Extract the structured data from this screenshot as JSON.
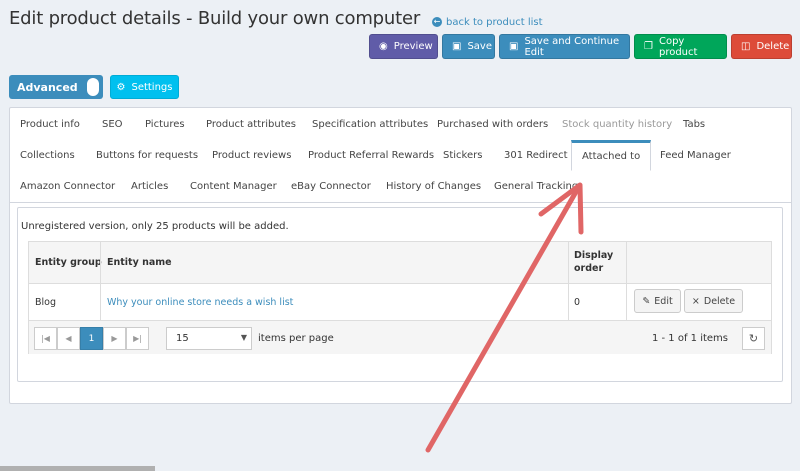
{
  "header": {
    "title": "Edit product details - Build your own computer",
    "back_link": "back to product list",
    "back_icon": "arrow-circle-left-icon"
  },
  "actions": {
    "preview": "Preview",
    "save": "Save",
    "save_continue": "Save and Continue Edit",
    "copy": "Copy product",
    "delete": "Delete"
  },
  "mode_toggle": {
    "label": "Advanced"
  },
  "settings_button": {
    "label": "Settings"
  },
  "tabs": {
    "row1": [
      "Product info",
      "SEO",
      "Pictures",
      "Product attributes",
      "Specification attributes",
      "Purchased with orders",
      "Stock quantity history",
      "Tabs"
    ],
    "row2": [
      "Collections",
      "Buttons for requests",
      "Product reviews",
      "Product Referral Rewards",
      "Stickers",
      "301 Redirect",
      "Attached to",
      "Feed Manager"
    ],
    "row3": [
      "Amazon Connector",
      "Articles",
      "Content Manager",
      "eBay Connector",
      "History of Changes",
      "General Tracking"
    ],
    "active": "Attached to"
  },
  "notice": "Unregistered version, only 25 products will be added.",
  "grid": {
    "columns": [
      "Entity group",
      "Entity name",
      "Display",
      "order"
    ],
    "rows": [
      {
        "group": "Blog",
        "name": "Why your online store needs a wish list",
        "order": "0",
        "edit": "Edit",
        "delete": "Delete"
      }
    ]
  },
  "pager": {
    "current_page": "1",
    "page_size": "15",
    "items_per_page": "items per page",
    "range": "1 - 1 of 1 items"
  },
  "colors": {
    "primary": "#3c8dbc",
    "purple": "#605ca8",
    "green": "#00a65a",
    "red": "#dd4b39",
    "info": "#00c0ef",
    "annotation_arrow": "#e06666"
  }
}
